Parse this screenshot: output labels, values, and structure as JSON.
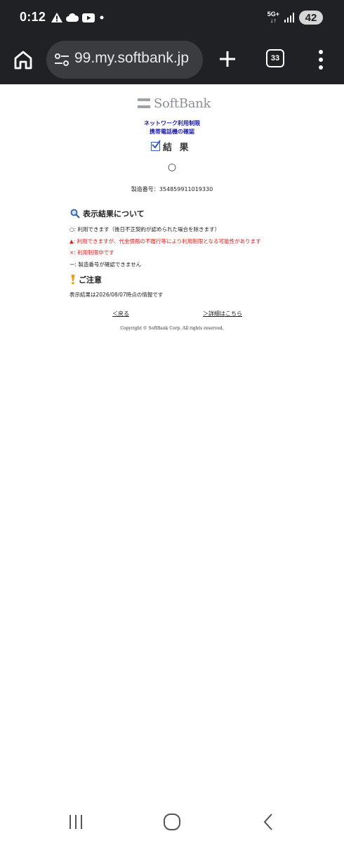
{
  "status_bar": {
    "time": "0:12",
    "network": "5G+",
    "battery": "42"
  },
  "browser": {
    "url": "99.my.softbank.jp",
    "tab_count": "33",
    "icons": [
      "home-icon",
      "site-settings-icon",
      "plus-icon",
      "tabs-icon",
      "menu-icon"
    ]
  },
  "page": {
    "brand": "SoftBank",
    "subtitle_line1": "ネットワーク利用制限",
    "subtitle_line2": "携帯電話機の確認",
    "result_title": "結 果",
    "result_symbol": "○",
    "serial_label": "製造番号：354859911019330",
    "about_title": "表示結果について",
    "legend": [
      {
        "text": "○: 利用できます（後日不正契約が認められた場合を除きます）",
        "color": "#222222"
      },
      {
        "text": "▲: 利用できますが、代金債務の不履行等により利用制限となる可能性があります",
        "color": "#e0201c"
      },
      {
        "text": "×: 利用制限中です",
        "color": "#e0201c"
      },
      {
        "text": "ー: 製造番号が確認できません",
        "color": "#222222"
      }
    ],
    "notice_title": "ご注意",
    "notice_text": "表示結果は2026/08/07時点の情報です",
    "back_link": "＜戻る",
    "details_link": "＞詳細はこちら",
    "copyright": "Copyright © SoftBank Corp. All rights reserved."
  },
  "colors": {
    "chrome_bg": "#1f2125",
    "link_blue": "#1a1aa8",
    "warning_red": "#e0201c"
  }
}
